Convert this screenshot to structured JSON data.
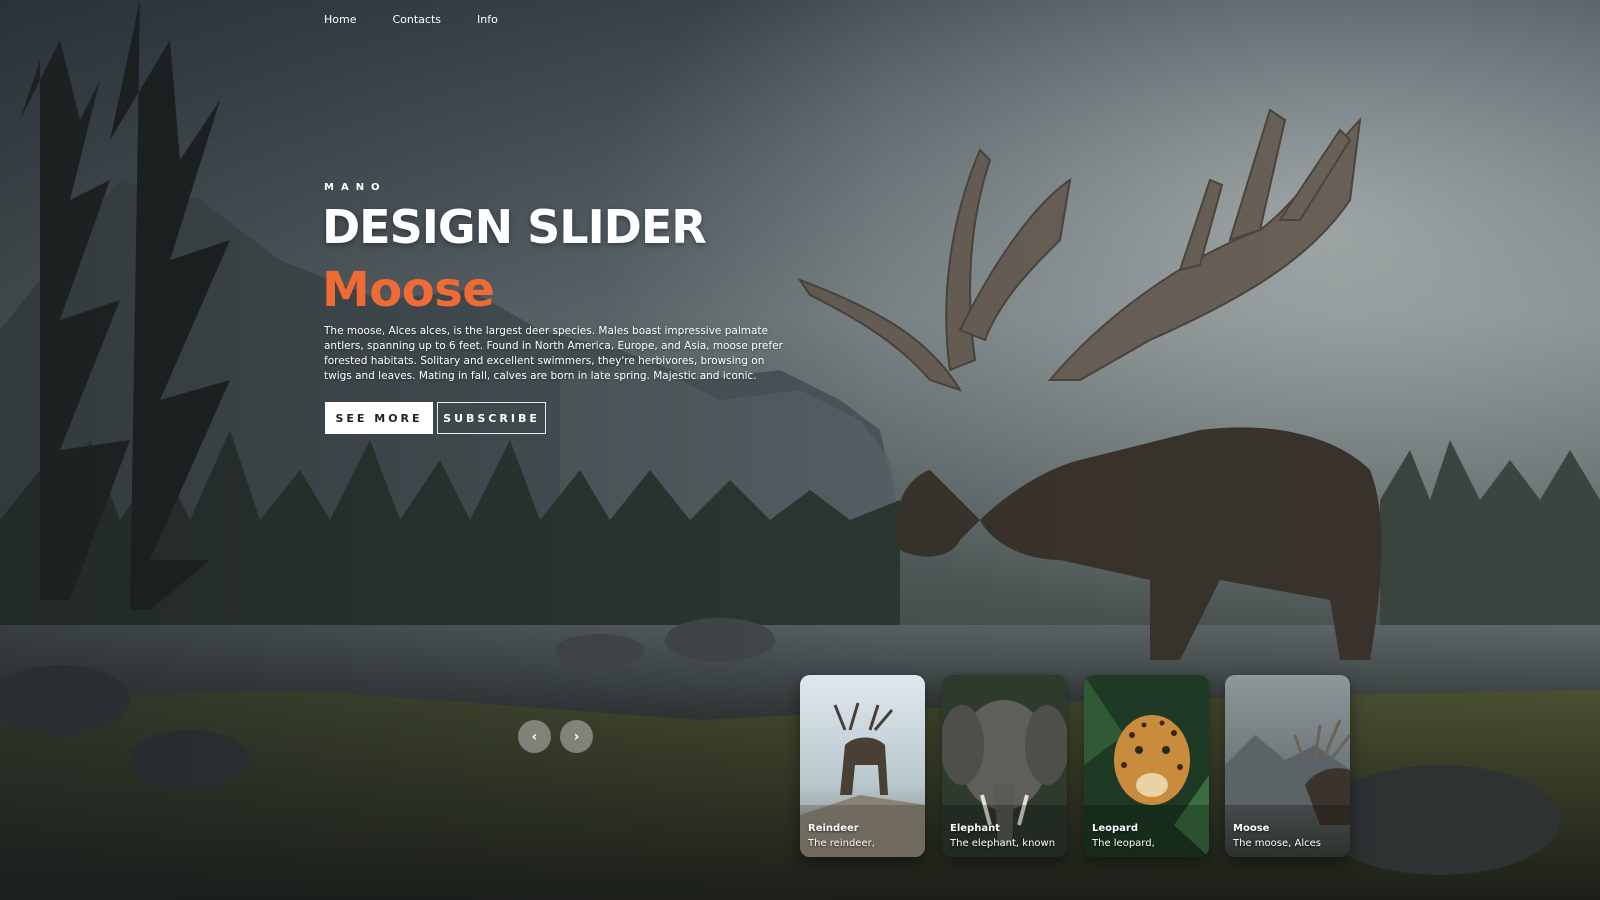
{
  "nav": {
    "items": [
      {
        "label": "Home"
      },
      {
        "label": "Contacts"
      },
      {
        "label": "Info"
      }
    ]
  },
  "hero": {
    "brand": "MANO",
    "title": "DESIGN SLIDER",
    "topic": "Moose",
    "description": "The moose, Alces alces, is the largest deer species. Males boast impressive palmate antlers, spanning up to 6 feet. Found in North America, Europe, and Asia, moose prefer forested habitats. Solitary and excellent swimmers, they're herbivores, browsing on twigs and leaves. Mating in fall, calves are born in late spring. Majestic and iconic.",
    "buttons": {
      "see_more": "SEE MORE",
      "subscribe": "SUBSCRIBE"
    }
  },
  "slider": {
    "prev_symbol": "‹",
    "next_symbol": "›"
  },
  "thumbnails": [
    {
      "title": "Reindeer",
      "desc": "The reindeer,"
    },
    {
      "title": "Elephant",
      "desc": "The elephant, known"
    },
    {
      "title": "Leopard",
      "desc": "The leopard,"
    },
    {
      "title": "Moose",
      "desc": "The moose, Alces"
    }
  ],
  "colors": {
    "accent": "#ef6a35"
  }
}
